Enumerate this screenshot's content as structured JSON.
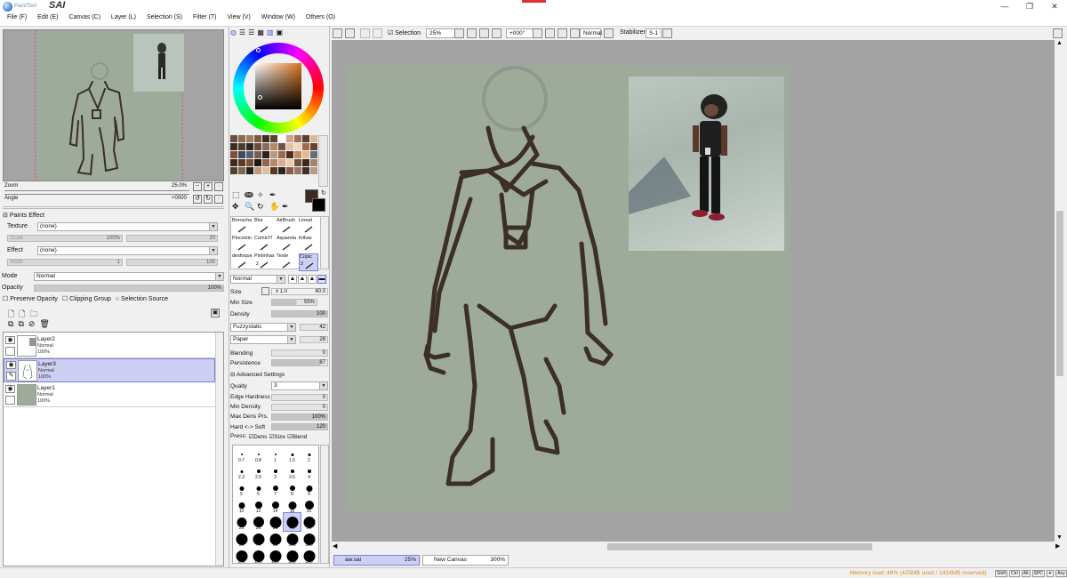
{
  "app": {
    "logo_small": "PaintTool",
    "logo_big": "SAI",
    "menu": [
      "File (F)",
      "Edit (E)",
      "Canvas (C)",
      "Layer (L)",
      "Selection (S)",
      "Filter (T)",
      "View (V)",
      "Window (W)",
      "Others (O)"
    ],
    "window_buttons": [
      "—",
      "❐",
      "✕"
    ]
  },
  "navigator": {
    "zoom_label": "Zoom",
    "zoom_value": "25.0%",
    "angle_label": "Angle",
    "angle_value": "+0000"
  },
  "paints_effect": {
    "title": "Paints Effect",
    "texture_label": "Texture",
    "texture_value": "(none)",
    "scale_label": "Scale",
    "scale_value": "100%",
    "scale_value2": "20",
    "effect_label": "Effect",
    "effect_value": "(none)",
    "width_label": "Width",
    "width_value": "1",
    "width_value2": "100"
  },
  "layer_props": {
    "mode_label": "Mode",
    "mode_value": "Normal",
    "opacity_label": "Opacity",
    "opacity_value": "100%",
    "preserve_opacity": "Preserve Opacity",
    "clipping_group": "Clipping Group",
    "selection_source": "Selection Source"
  },
  "layers": [
    {
      "name": "Layer2",
      "mode": "Normal",
      "opacity": "100%",
      "selected": false
    },
    {
      "name": "Layer3",
      "mode": "Normal",
      "opacity": "100%",
      "selected": true
    },
    {
      "name": "Layer1",
      "mode": "Normal",
      "opacity": "100%",
      "selected": false
    }
  ],
  "tools": [
    {
      "name": "Borracha"
    },
    {
      "name": "Blur"
    },
    {
      "name": "AirBrush"
    },
    {
      "name": "Lineat"
    },
    {
      "name": "Pincelzin"
    },
    {
      "name": "Comic!!!"
    },
    {
      "name": "Aquarela"
    },
    {
      "name": "folhas"
    },
    {
      "name": "desfoque"
    },
    {
      "name": "Pintinhas"
    },
    {
      "name": "Teste"
    },
    {
      "name": "Copic"
    }
  ],
  "tool_numbers": [
    "2",
    "2"
  ],
  "brush": {
    "blend_mode": "Normal",
    "size_label": "Size",
    "size_mult": "x 1.0",
    "size_value": "40.0",
    "min_size_label": "Min Size",
    "min_size_value": "55%",
    "density_label": "Density",
    "density_value": "100",
    "shape_value": "Fuzzystatic",
    "shape_num": "42",
    "texture_value": "Paper",
    "texture_num": "28",
    "blending_label": "Blending",
    "blending_value": "0",
    "persistence_label": "Persistence",
    "persistence_value": "87",
    "advanced_label": "Advanced Settings",
    "quality_label": "Qualty",
    "quality_value": "3",
    "edge_hardness_label": "Edge Hardness",
    "edge_hardness_value": "0",
    "min_density_label": "Min Density",
    "min_density_value": "0",
    "max_dens_label": "Max Dens Prs.",
    "max_dens_value": "100%",
    "hard_soft_label": "Hard <-> Soft",
    "hard_soft_value": "120",
    "press_label": "Press:",
    "press_dens": "Dens",
    "press_size": "Size",
    "press_blend": "Blend"
  },
  "brush_sizes": [
    "0.7",
    "0.8",
    "1",
    "1.5",
    "2",
    "2.3",
    "2.6",
    "3",
    "3.5",
    "4",
    "5",
    "6",
    "7",
    "8",
    "9",
    "10",
    "12",
    "14",
    "16",
    "20",
    "25",
    "30",
    "35",
    "40",
    "50",
    "60",
    "70",
    "80",
    "100",
    "120",
    "160",
    "200",
    "250",
    "300",
    "350"
  ],
  "canvas_toolbar": {
    "selection_label": "Selection",
    "zoom_value": "25%",
    "angle_value": "+000°",
    "blend_value": "Normal",
    "stabilizer_label": "Stabilizer",
    "stabilizer_value": "S-1"
  },
  "tabs": [
    {
      "name": "aw.sai",
      "zoom": "25%",
      "active": true
    },
    {
      "name": "New Canvas",
      "zoom": "300%",
      "active": false
    }
  ],
  "status": {
    "memory": "Memory load: 48% (425MB used / 1434MB reserved)",
    "keys": [
      "Shift",
      "Ctrl",
      "Alt",
      "SPC",
      "",
      "Any"
    ]
  },
  "colors": {
    "accent_selected_layer": "#cdd0f4",
    "canvas_paper": "#9eab9a",
    "workspace": "#a3a3a3",
    "foreground_color": "#3a2b20",
    "memory_text": "#e08a1e"
  }
}
